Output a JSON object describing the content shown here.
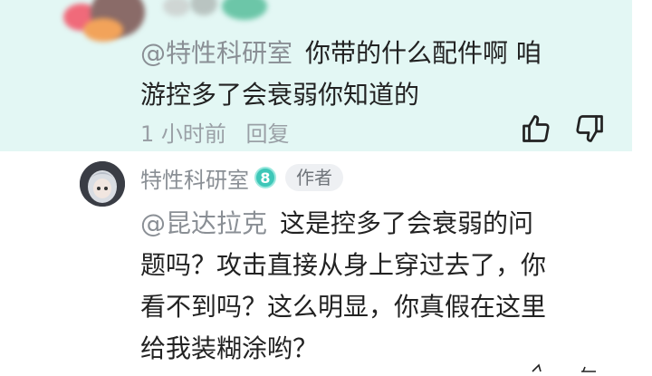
{
  "reply": {
    "mention": "@特性科研室",
    "text_line1": "你带的什么配件啊 咱",
    "text_line2": "游控多了会衰弱你知道的",
    "time": "1 小时前",
    "reply_label": "回复"
  },
  "comment": {
    "author": "特性科研室",
    "level": "8",
    "author_tag": "作者",
    "mention": "@昆达拉克",
    "text_line1": "这是控多了会衰弱的问",
    "text_line2": "题吗？攻击直接从身上穿过去了，你",
    "text_line3": "看不到吗？这么明显，你真假在这里",
    "text_line4": "给我装糊涂哟？"
  },
  "colors": {
    "highlight_bg": "#e3f7f4",
    "muted_text": "#9aa0a6",
    "level_badge": "#3ec7b8"
  },
  "icons": [
    "thumbs-up-icon",
    "thumbs-down-icon"
  ]
}
